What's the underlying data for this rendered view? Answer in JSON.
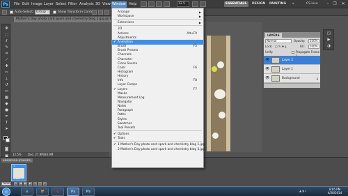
{
  "menubar": {
    "logo": "Ps",
    "items": [
      "File",
      "Edit",
      "Image",
      "Layer",
      "Select",
      "Filter",
      "Analysis",
      "3D",
      "View",
      "Window",
      "Help"
    ],
    "zoom": "12.5",
    "workspaces": [
      "ESSENTIALS",
      "DESIGN",
      "PAINTING"
    ],
    "more": "»",
    "cs_live": "CS Live"
  },
  "options": {
    "auto_select_label": "Auto-Select:",
    "auto_select_value": "Group",
    "show_transform_label": "Show Transform Controls"
  },
  "document": {
    "tab": "Mother's Day photo card spark and chemistry blog 1.jpg @ 12.5% (Layer 2, RGB/8) *",
    "zoom_status": "12.5%",
    "doc_status": "Doc: 27.9M/80.9M"
  },
  "window_menu": {
    "items": [
      {
        "label": "Arrange",
        "arrow": true
      },
      {
        "label": "Workspace",
        "arrow": true
      },
      {
        "sep": true
      },
      {
        "label": "Extensions",
        "arrow": true
      },
      {
        "sep": true
      },
      {
        "label": "3D"
      },
      {
        "label": "Actions",
        "shortcut": "Alt+F9"
      },
      {
        "label": "Adjustments"
      },
      {
        "label": "Animation",
        "checked": true,
        "highlighted": true
      },
      {
        "label": "Brush",
        "shortcut": "F5"
      },
      {
        "label": "Brush Presets"
      },
      {
        "label": "Channels"
      },
      {
        "label": "Character"
      },
      {
        "label": "Clone Source"
      },
      {
        "label": "Color",
        "shortcut": "F6"
      },
      {
        "label": "Histogram"
      },
      {
        "label": "History"
      },
      {
        "label": "Info",
        "shortcut": "F8"
      },
      {
        "label": "Layer Comps"
      },
      {
        "label": "Layers",
        "shortcut": "F7",
        "checked": true
      },
      {
        "label": "Masks"
      },
      {
        "label": "Measurement Log"
      },
      {
        "label": "Navigator"
      },
      {
        "label": "Notes"
      },
      {
        "label": "Paragraph"
      },
      {
        "label": "Paths"
      },
      {
        "label": "Styles"
      },
      {
        "label": "Swatches"
      },
      {
        "label": "Tool Presets"
      },
      {
        "sep": true
      },
      {
        "label": "Options",
        "checked": true
      },
      {
        "label": "Tools",
        "checked": true
      },
      {
        "sep": true
      },
      {
        "label": "1 Mother's Day photo card spark and chemistry blog 1.jpg",
        "checked": true
      },
      {
        "label": "2 Mother's Day photo card spark and chemistry blog 3.jpg"
      }
    ]
  },
  "layers_panel": {
    "tab": "LAYERS",
    "blend_mode": "Normal",
    "opacity_label": "Opacity:",
    "opacity": "100%",
    "lock_label": "Lock:",
    "fill_label": "Fill:",
    "fill": "100%",
    "unify_label": "Unify:",
    "propagate_label": "Propagate Frame 1",
    "layers": [
      {
        "name": "Layer 2",
        "selected": true
      },
      {
        "name": "Layer 1",
        "selected": false
      },
      {
        "name": "Background",
        "selected": false
      }
    ]
  },
  "animation": {
    "tab": "ANIMATION (FRAMES)",
    "frame_number": "1",
    "frame_time": "0 sec.",
    "loop": "Forever"
  },
  "taskbar": {
    "apps": [
      "e",
      "ff",
      "o",
      "Ps",
      "Ps"
    ],
    "time": "8:05 PM",
    "date": "4/28/2014"
  }
}
